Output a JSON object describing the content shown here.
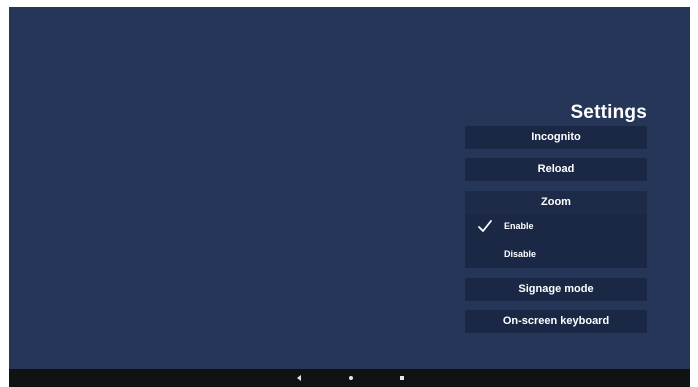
{
  "settings": {
    "title": "Settings",
    "incognito_label": "Incognito",
    "reload_label": "Reload",
    "zoom": {
      "label": "Zoom",
      "options": [
        {
          "label": "Enable",
          "selected": true
        },
        {
          "label": "Disable",
          "selected": false
        }
      ]
    },
    "signage_label": "Signage mode",
    "keyboard_label": "On-screen keyboard"
  },
  "navbar": {
    "icons": [
      "back-icon",
      "home-icon",
      "recent-apps-icon"
    ]
  },
  "colors": {
    "background": "#263658",
    "menu_item": "#1b2845",
    "navbar": "#101214",
    "text": "#ffffff"
  }
}
